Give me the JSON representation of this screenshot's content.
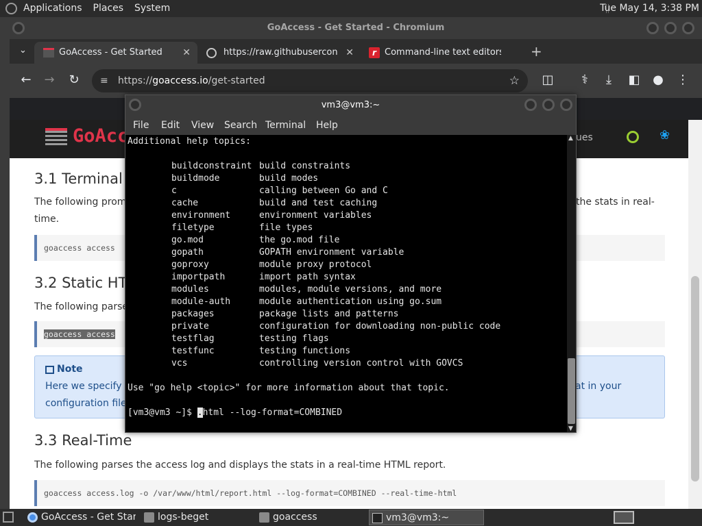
{
  "top_panel": {
    "menus": [
      "Applications",
      "Places",
      "System"
    ],
    "clock": "Tue May 14,  3:38 PM"
  },
  "browser": {
    "window_title": "GoAccess - Get Started - Chromium",
    "tabs": [
      {
        "label": "GoAccess - Get Started",
        "active": true
      },
      {
        "label": "https://raw.githubuserconten",
        "active": false
      },
      {
        "label": "Command-line text editors in",
        "active": false
      }
    ],
    "url_prefix": "https://",
    "url_host": "goaccess.io",
    "url_path": "/get-started"
  },
  "page": {
    "logo_text": "GoAcc",
    "nav_partial": "ues",
    "h_terminal": "3.1 Terminal O",
    "p_terminal_1": "The following promp",
    "p_terminal_2": "time.",
    "p_terminal_right": "the stats in real-",
    "code_terminal": "goaccess access",
    "h_static": "3.2 Static HTM",
    "p_static": "The following parser",
    "code_static": "goaccess access",
    "note_title": "Note",
    "note_line1": "Here we specify th",
    "note_line2": "configuration file",
    "note_right": "at in your",
    "h_realtime": "3.3 Real-Time",
    "p_realtime": "The following parses the access log and displays the stats in a real-time HTML report.",
    "code_realtime": "goaccess access.log -o /var/www/html/report.html --log-format=COMBINED --real-time-html"
  },
  "terminal": {
    "title": "vm3@vm3:~",
    "menu": [
      "File",
      "Edit",
      "View",
      "Search",
      "Terminal",
      "Help"
    ],
    "header": "Additional help topics:",
    "topics": [
      {
        "name": "buildconstraint",
        "desc": "build constraints"
      },
      {
        "name": "buildmode",
        "desc": "build modes"
      },
      {
        "name": "c",
        "desc": "calling between Go and C"
      },
      {
        "name": "cache",
        "desc": "build and test caching"
      },
      {
        "name": "environment",
        "desc": "environment variables"
      },
      {
        "name": "filetype",
        "desc": "file types"
      },
      {
        "name": "go.mod",
        "desc": "the go.mod file"
      },
      {
        "name": "gopath",
        "desc": "GOPATH environment variable"
      },
      {
        "name": "goproxy",
        "desc": "module proxy protocol"
      },
      {
        "name": "importpath",
        "desc": "import path syntax"
      },
      {
        "name": "modules",
        "desc": "modules, module versions, and more"
      },
      {
        "name": "module-auth",
        "desc": "module authentication using go.sum"
      },
      {
        "name": "packages",
        "desc": "package lists and patterns"
      },
      {
        "name": "private",
        "desc": "configuration for downloading non-public code"
      },
      {
        "name": "testflag",
        "desc": "testing flags"
      },
      {
        "name": "testfunc",
        "desc": "testing functions"
      },
      {
        "name": "vcs",
        "desc": "controlling version control with GOVCS"
      }
    ],
    "footer": "Use \"go help <topic>\" for more information about that topic.",
    "prompt": "[vm3@vm3 ~]$ ",
    "cursor_char": ".",
    "command_rest": "html --log-format=COMBINED"
  },
  "taskbar": {
    "items": [
      {
        "label": "GoAccess - Get Star...",
        "icon": "chromium-icon",
        "active": false
      },
      {
        "label": "logs-beget",
        "icon": "folder-icon",
        "active": false
      },
      {
        "label": "goaccess",
        "icon": "folder-icon",
        "active": false
      },
      {
        "label": "vm3@vm3:~",
        "icon": "terminal-icon",
        "active": true
      }
    ]
  },
  "colors": {
    "brand_logo": "#e0344a",
    "github_icon": "#9acd32",
    "twitter_icon": "#1da1f2",
    "code_border": "#5b7db1"
  }
}
